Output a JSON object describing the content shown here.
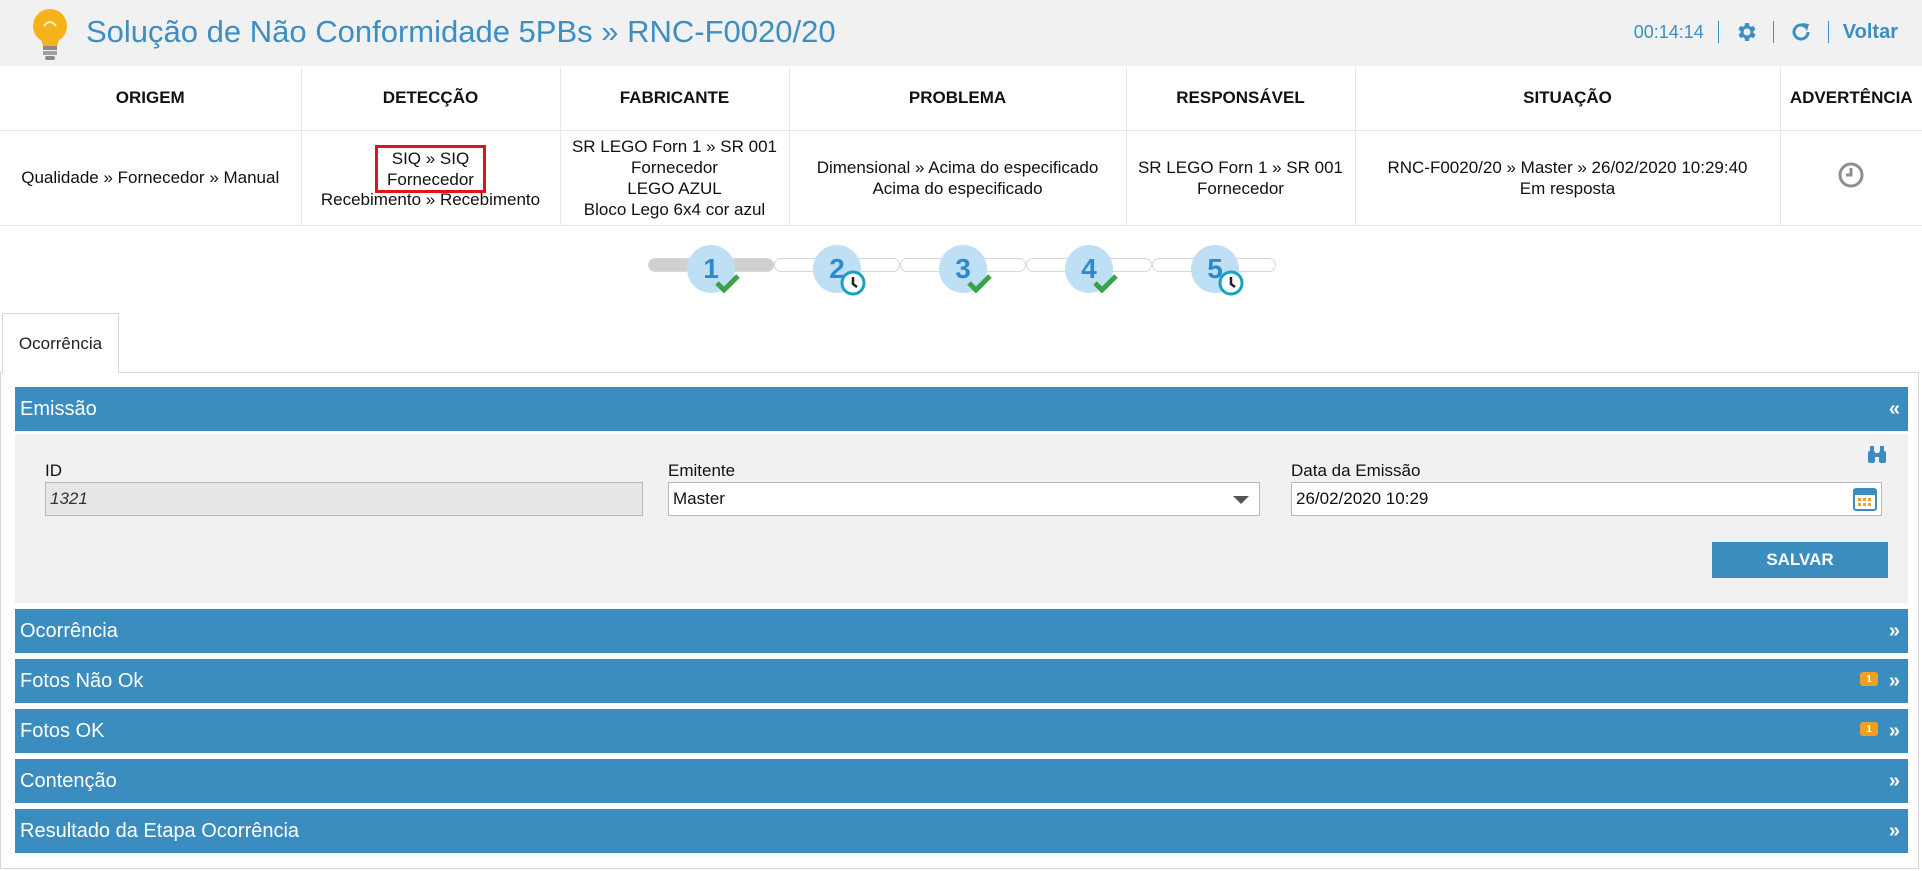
{
  "header": {
    "title": "Solução de Não Conformidade 5PBs » RNC-F0020/20",
    "timer": "00:14:14",
    "back_label": "Voltar",
    "icons": [
      "gear-icon",
      "refresh-icon"
    ]
  },
  "info_table": {
    "headers": [
      "ORIGEM",
      "DETECÇÃO",
      "FABRICANTE",
      "PROBLEMA",
      "RESPONSÁVEL",
      "SITUAÇÃO",
      "ADVERTÊNCIA"
    ],
    "origem": "Qualidade » Fornecedor » Manual",
    "deteccao": {
      "highlight_line1": "SIQ » SIQ",
      "highlight_line2": "Fornecedor",
      "line3": "Recebimento » Recebimento"
    },
    "fabricante": {
      "line1": "SR LEGO Forn 1 » SR 001",
      "line2": "Fornecedor",
      "line3": "LEGO AZUL",
      "line4": "Bloco Lego 6x4 cor azul"
    },
    "problema": {
      "line1": "Dimensional » Acima do especificado",
      "line2": "Acima do especificado"
    },
    "responsavel": {
      "line1": "SR LEGO Forn 1 » SR 001",
      "line2": "Fornecedor"
    },
    "situacao": {
      "line1": "RNC-F0020/20 » Master » 26/02/2020 10:29:40",
      "line2": "Em resposta"
    },
    "advertencia_icon": "clock-icon"
  },
  "steps": [
    {
      "number": "1",
      "status": "done"
    },
    {
      "number": "2",
      "status": "pending"
    },
    {
      "number": "3",
      "status": "done"
    },
    {
      "number": "4",
      "status": "done"
    },
    {
      "number": "5",
      "status": "pending"
    }
  ],
  "tabs": [
    {
      "label": "Ocorrência",
      "active": true
    }
  ],
  "panels": {
    "emissao": {
      "title": "Emissão",
      "chevron": "«",
      "fields": {
        "id_label": "ID",
        "id_value": "1321",
        "emitente_label": "Emitente",
        "emitente_value": "Master",
        "data_label": "Data da Emissão",
        "data_value": "26/02/2020 10:29"
      },
      "save_label": "SALVAR"
    },
    "collapsed": [
      {
        "title": "Ocorrência",
        "chevron": "»",
        "badge": ""
      },
      {
        "title": "Fotos Não Ok",
        "chevron": "»",
        "badge": "1"
      },
      {
        "title": "Fotos OK",
        "chevron": "»",
        "badge": "1"
      },
      {
        "title": "Contenção",
        "chevron": "»",
        "badge": ""
      },
      {
        "title": "Resultado da Etapa Ocorrência",
        "chevron": "»",
        "badge": ""
      }
    ]
  },
  "colors": {
    "primary": "#3b8cbf",
    "title": "#3d8ec2",
    "highlight": "#e3131e",
    "badge": "#f0a021",
    "step_circle": "#bfdff4",
    "check": "#3aa34a",
    "clock_badge": "#1aa3c0"
  }
}
